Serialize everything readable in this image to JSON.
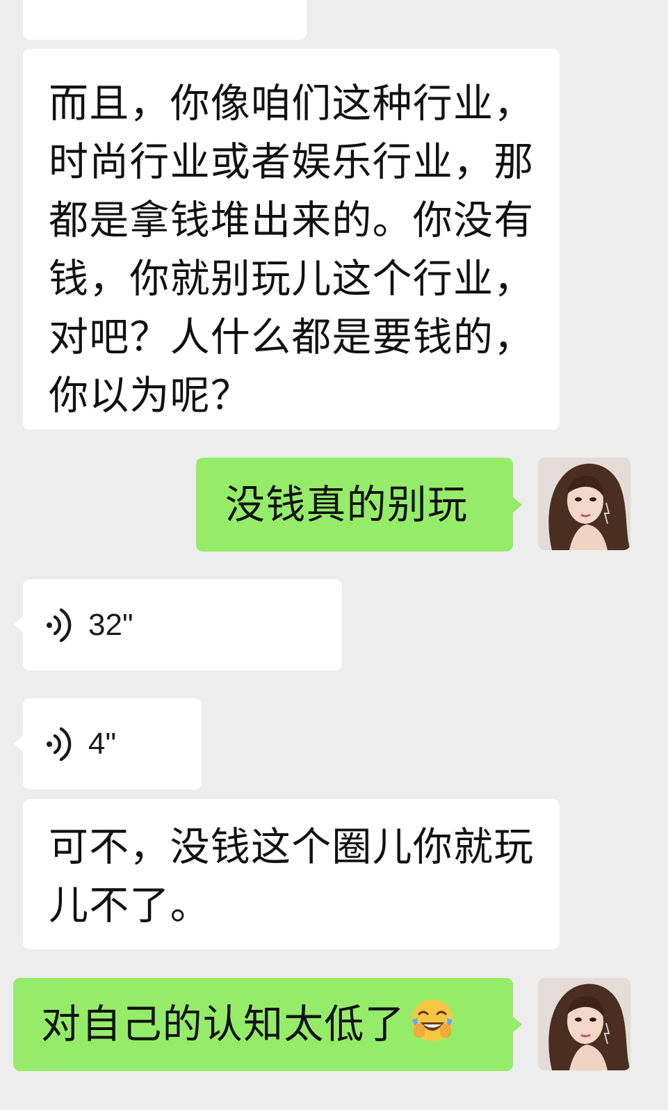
{
  "messages": [
    {
      "id": "m0",
      "side": "incoming",
      "type": "text",
      "text": ""
    },
    {
      "id": "m1",
      "side": "incoming",
      "type": "text",
      "text": "而且，你像咱们这种行业，时尚行业或者娱乐行业，那都是拿钱堆出来的。你没有钱，你就别玩儿这个行业，对吧？人什么都是要钱的，你以为呢？"
    },
    {
      "id": "m2",
      "side": "outgoing",
      "type": "text",
      "text": "没钱真的别玩"
    },
    {
      "id": "m3",
      "side": "incoming",
      "type": "voice",
      "duration": "32\""
    },
    {
      "id": "m4",
      "side": "incoming",
      "type": "voice",
      "duration": "4\""
    },
    {
      "id": "m5",
      "side": "incoming",
      "type": "text",
      "text": "可不，没钱这个圈儿你就玩儿不了。"
    },
    {
      "id": "m6",
      "side": "outgoing",
      "type": "text",
      "text": "对自己的认知太低了",
      "emoji": "crying-laughing-emoji"
    }
  ],
  "colors": {
    "background": "#ededed",
    "incoming_bubble": "#ffffff",
    "outgoing_bubble": "#95ec69",
    "text": "#111111"
  }
}
